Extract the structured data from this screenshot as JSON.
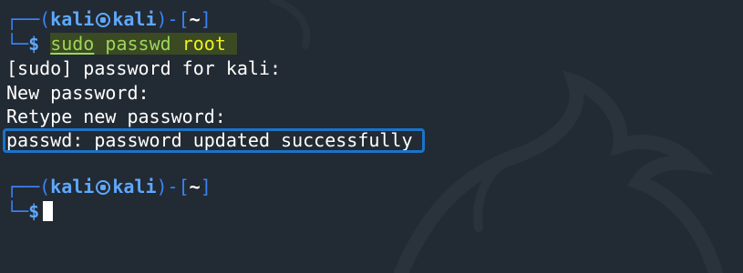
{
  "prompt_user": "kali",
  "prompt_host": "kali",
  "prompt_dir": "~",
  "prompt_symbol": "$",
  "command": {
    "sudo": "sudo",
    "passwd": "passwd",
    "arg": "root"
  },
  "output": [
    "[sudo] password for kali:",
    "New password:",
    "Retype new password:",
    "passwd: password updated successfully"
  ],
  "colors": {
    "background": "#222a33",
    "prompt_frame": "#3b82f6",
    "prompt_user": "#5ea9ff",
    "command": "#9cd65a",
    "argument": "#f0f01e",
    "highlight_border": "#1a73c8"
  }
}
